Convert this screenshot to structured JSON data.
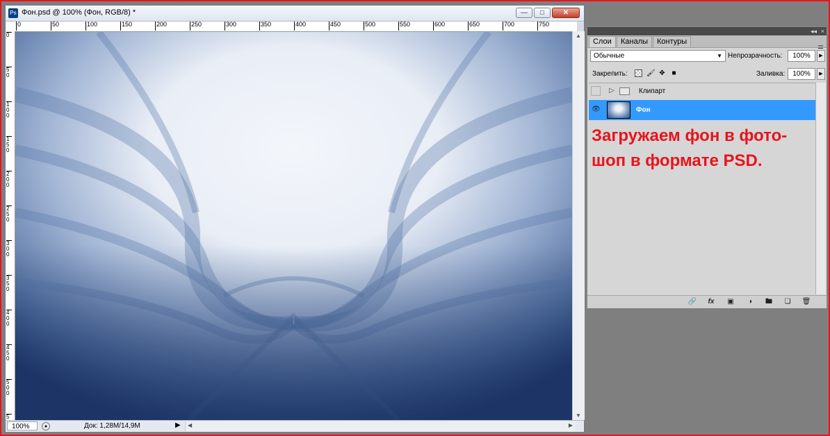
{
  "document": {
    "app_icon_text": "Ps",
    "title": "Фон.psd @ 100% (Фон, RGB/8) *",
    "ruler_h_labels": [
      "0",
      "50",
      "100",
      "150",
      "200",
      "250",
      "300",
      "350",
      "400",
      "450",
      "500",
      "550",
      "600",
      "650",
      "700",
      "750"
    ],
    "ruler_v_labels": [
      "0",
      "50",
      "100",
      "150",
      "200",
      "250",
      "300",
      "350",
      "400",
      "450",
      "500",
      "550"
    ],
    "zoom": "100%",
    "doc_info": "Док: 1,28M/14,9M"
  },
  "panel": {
    "tabs": [
      "Слои",
      "Каналы",
      "Контуры"
    ],
    "blend_mode": "Обычные",
    "opacity_label": "Непрозрачность:",
    "opacity_value": "100%",
    "lock_label": "Закрепить:",
    "fill_label": "Заливка:",
    "fill_value": "100%",
    "layers": [
      {
        "name": "Клипарт",
        "type": "group",
        "visible": false,
        "selected": false
      },
      {
        "name": "Фон",
        "type": "layer",
        "visible": true,
        "selected": true
      }
    ]
  },
  "annotation": {
    "line1": "Загружаем фон в фото-",
    "line2": "шоп в формате PSD."
  },
  "colors": {
    "selection": "#3399ff",
    "annotation": "#e8141c",
    "frame": "#e8141c"
  }
}
